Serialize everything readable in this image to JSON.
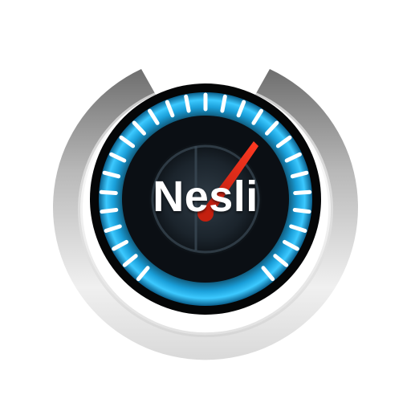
{
  "app_icon": {
    "label": "Nesli",
    "icon": "speedometer-gauge-icon",
    "colors": {
      "label": "#ffffff",
      "needle": "#e02a18",
      "glow": "#19b7ff",
      "ticks": "#ffffff",
      "bezel_light": "#f2f2f2",
      "bezel_dark": "#8a8a8a",
      "dial_dark": "#0b0f14"
    }
  }
}
